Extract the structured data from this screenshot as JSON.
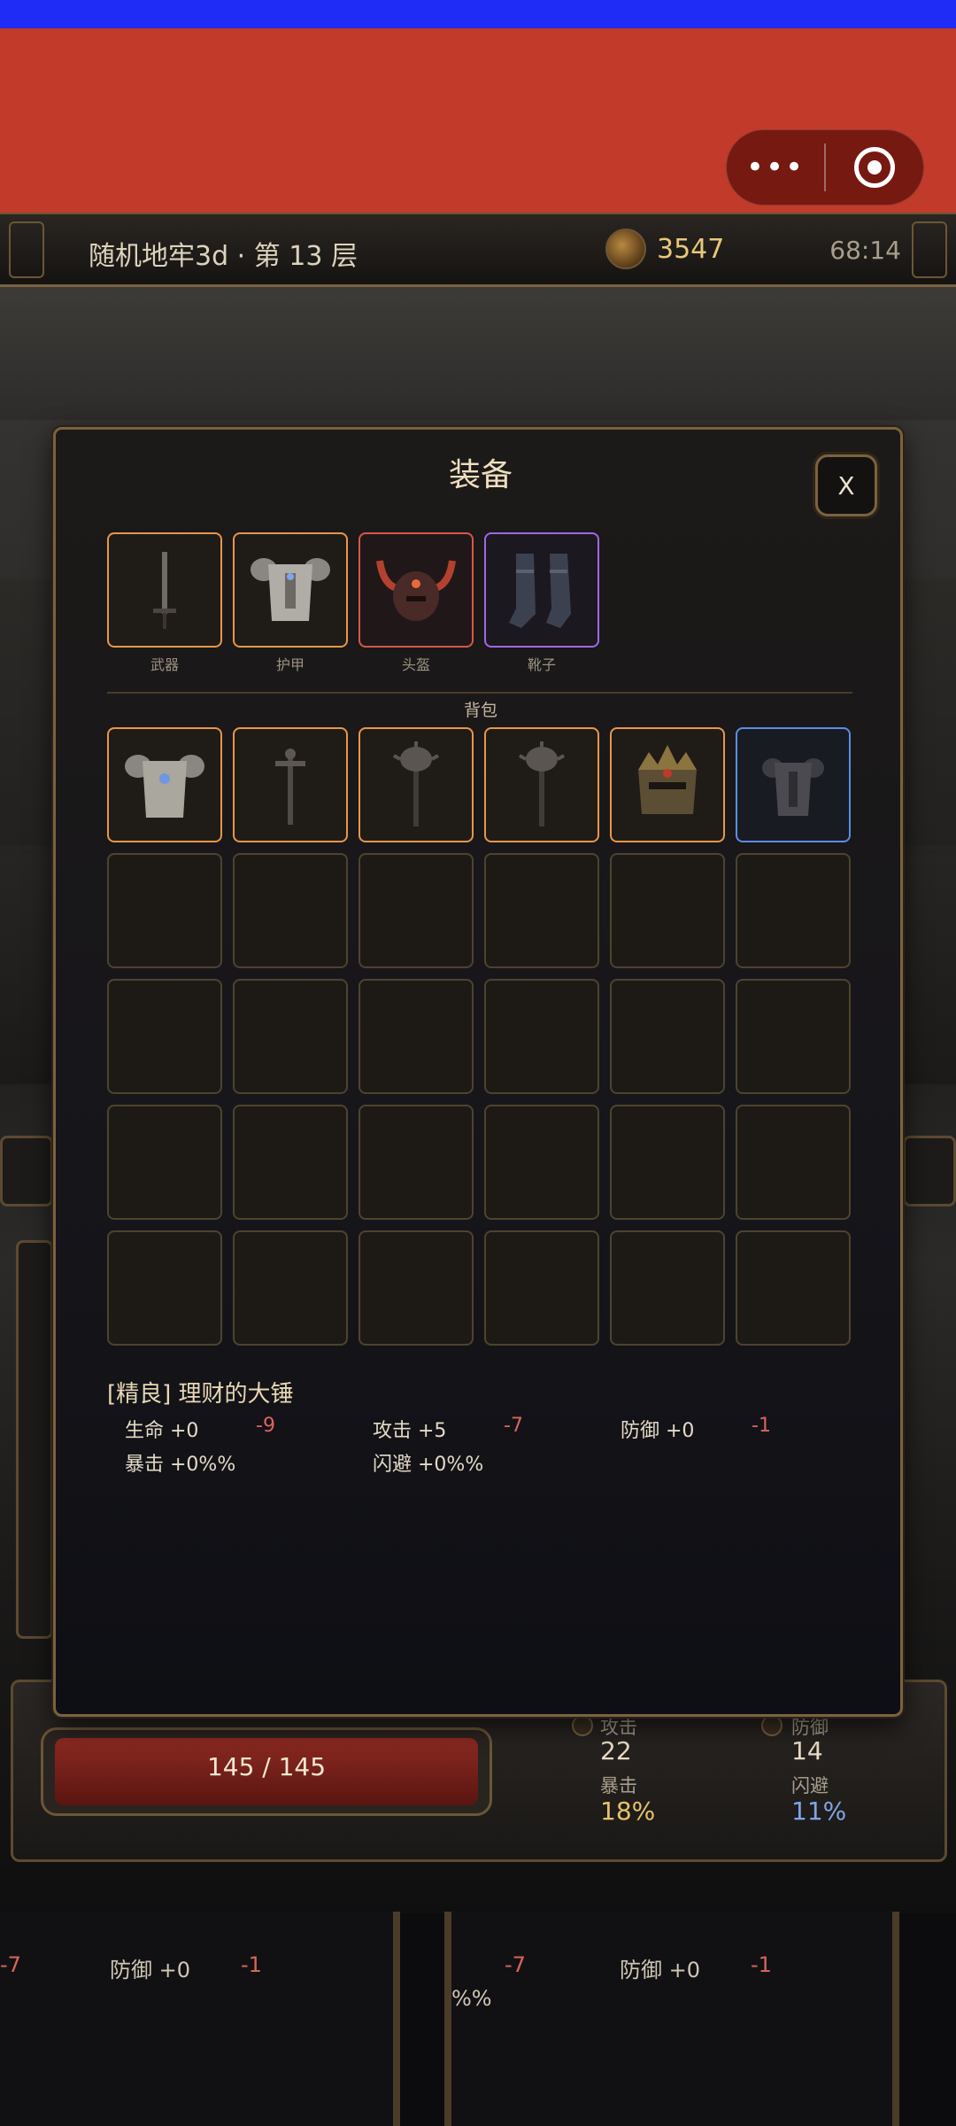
{
  "header": {
    "title": "随机地牢3d · 第 13 层",
    "gold": "3547",
    "timer": "68:14",
    "menu_dots": "•••"
  },
  "panel": {
    "title": "装备",
    "close_label": "X",
    "equipped": [
      {
        "label": "武器",
        "icon": "sword-icon",
        "quality": "orange"
      },
      {
        "label": "护甲",
        "icon": "plate-armor-icon",
        "quality": "orange"
      },
      {
        "label": "头盔",
        "icon": "horned-helmet-icon",
        "quality": "red"
      },
      {
        "label": "靴子",
        "icon": "boots-icon",
        "quality": "purple"
      }
    ],
    "bag_label": "背包",
    "bag_items": [
      {
        "icon": "plate-armor-icon",
        "quality": "orange"
      },
      {
        "icon": "cross-staff-icon",
        "quality": "orange"
      },
      {
        "icon": "mace-icon",
        "quality": "orange"
      },
      {
        "icon": "mace-icon",
        "quality": "orange"
      },
      {
        "icon": "crowned-helmet-icon",
        "quality": "orange"
      },
      {
        "icon": "dark-armor-icon",
        "quality": "blue"
      }
    ],
    "selected_item": {
      "name": "[精良] 理财的大锤",
      "hp": "生命 +0",
      "hp_diff": "-9",
      "atk": "攻击 +5",
      "atk_diff": "-7",
      "def": "防御 +0",
      "def_diff": "-1",
      "crit": "暴击 +0%%",
      "dodge": "闪避 +0%%"
    }
  },
  "hud": {
    "hp": "145 / 145",
    "atk_label": "攻击",
    "atk_value": "22",
    "def_label": "防御",
    "def_value": "14",
    "crit_label": "暴击",
    "crit_value": "18%",
    "dodge_label": "闪避",
    "dodge_value": "11%"
  },
  "behind": {
    "left_diff": "-7",
    "left_def": "防御 +0",
    "left_def_diff": "-1",
    "right_diff": "-7",
    "right_def": "防御 +0",
    "right_def_diff": "-1",
    "right_pct": "%%"
  },
  "colors": {
    "status_bar": "#1f2cf5",
    "nav_bar": "#c23a2a",
    "quality_orange": "#e8964a",
    "quality_red": "#d9564a",
    "quality_purple": "#a067e8",
    "quality_blue": "#5c8ce8",
    "diff_red": "#d9655a"
  }
}
